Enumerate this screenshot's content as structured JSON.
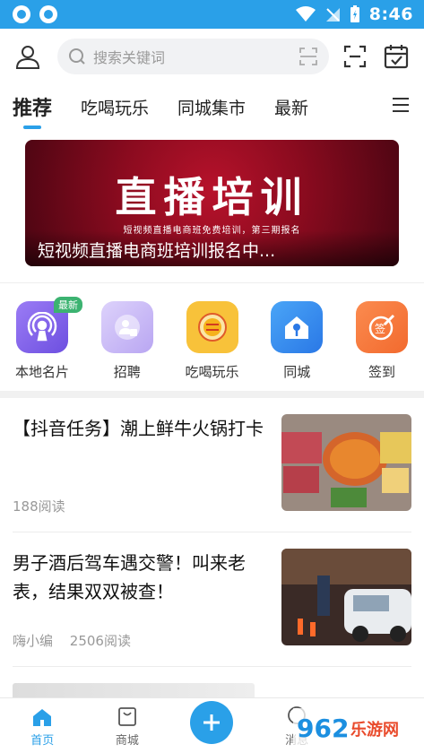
{
  "status_bar": {
    "time": "8:46"
  },
  "search": {
    "placeholder": "搜索关键词"
  },
  "tabs": [
    {
      "label": "推荐",
      "active": true
    },
    {
      "label": "吃喝玩乐",
      "active": false
    },
    {
      "label": "同城集市",
      "active": false
    },
    {
      "label": "最新",
      "active": false
    }
  ],
  "banner": {
    "headline": "直播培训",
    "subline": "短视频直播电商班免费培训，第三期报名",
    "caption": "短视频直播电商班培训报名中..."
  },
  "quick_links": [
    {
      "label": "本地名片",
      "icon": "podcast-icon",
      "color": "#8a6cf0",
      "badge": "最新"
    },
    {
      "label": "招聘",
      "icon": "user-card-icon",
      "color": "#b9a6f2",
      "badge": ""
    },
    {
      "label": "吃喝玩乐",
      "icon": "food-badge-icon",
      "color": "#f6b21b",
      "badge": ""
    },
    {
      "label": "同城",
      "icon": "house-pin-icon",
      "color": "#3a8ff0",
      "badge": ""
    },
    {
      "label": "签到",
      "icon": "sign-pen-icon",
      "color": "#f5753b",
      "badge": ""
    }
  ],
  "feed": [
    {
      "title": "【抖音任务】潮上鲜牛火锅打卡",
      "author": "",
      "reads": "188阅读"
    },
    {
      "title": "男子酒后驾车遇交警！叫来老表，结果双双被查！",
      "author": "嗨小编",
      "reads": "2506阅读"
    }
  ],
  "bottom_nav": {
    "home": "首页",
    "mall": "商城",
    "messages": "消息"
  },
  "watermark": "962乐游网",
  "colors": {
    "accent": "#2aa0e8",
    "badge_green": "#3cb371"
  }
}
